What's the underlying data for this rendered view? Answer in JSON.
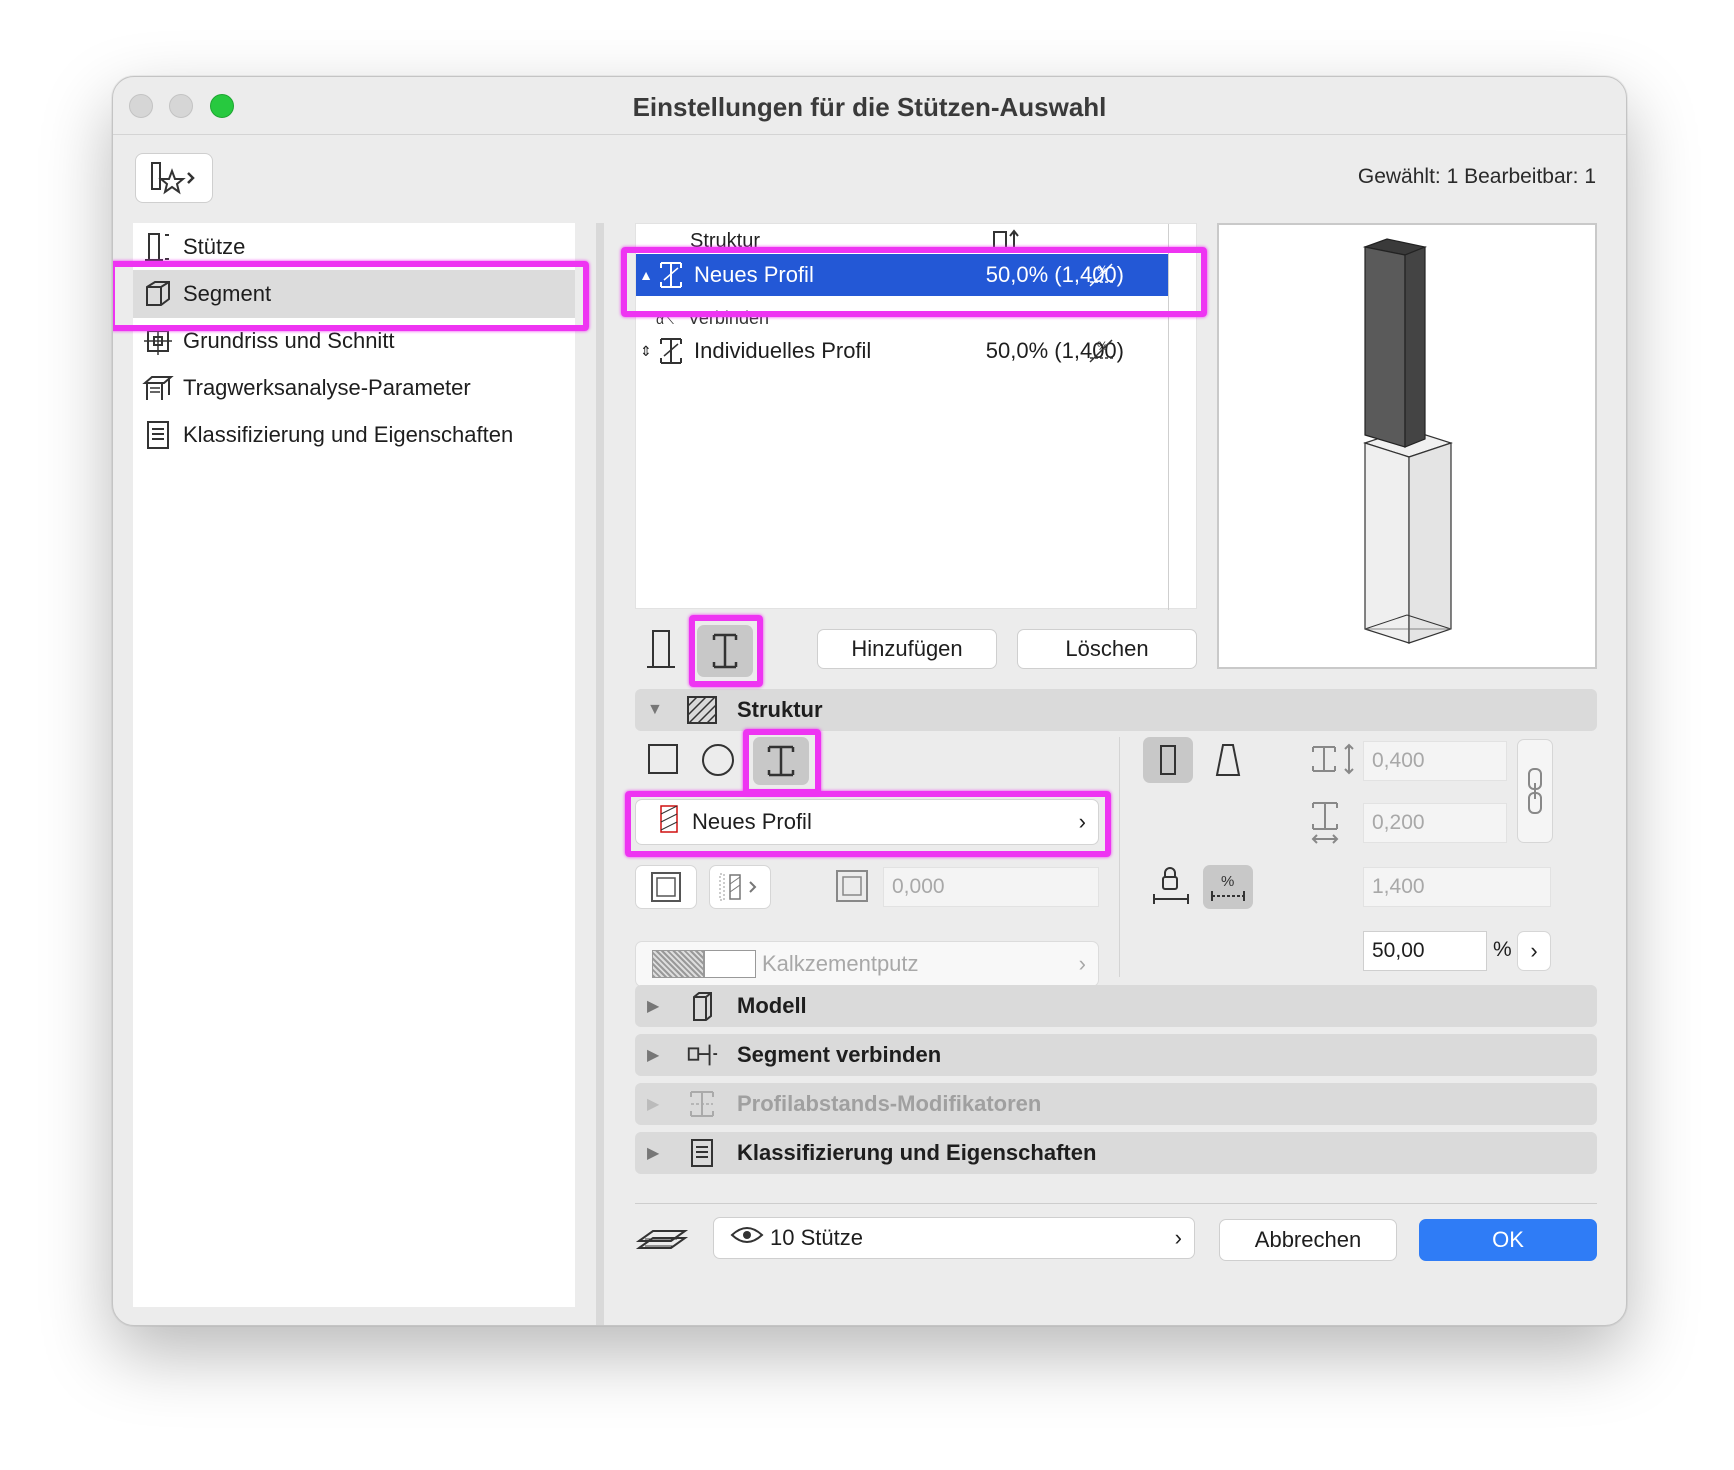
{
  "window": {
    "title": "Einstellungen für die Stützen-Auswahl",
    "selected_info": "Gewählt: 1 Bearbeitbar: 1"
  },
  "sidebar": {
    "items": [
      {
        "label": "Stütze",
        "icon": "column-icon"
      },
      {
        "label": "Segment",
        "icon": "segment-icon",
        "selected": true
      },
      {
        "label": "Grundriss und Schnitt",
        "icon": "floorplan-icon"
      },
      {
        "label": "Tragwerksanalyse-Parameter",
        "icon": "structural-analysis-icon"
      },
      {
        "label": "Klassifizierung und Eigenschaften",
        "icon": "classification-icon"
      }
    ]
  },
  "segments": {
    "header": "Struktur",
    "connect_label": "Verbinden",
    "rows": [
      {
        "name": "Neues Profil",
        "value": "50,0% (1,400)",
        "selected": true
      },
      {
        "name": "Individuelles Profil",
        "value": "50,0% (1,400)",
        "selected": false
      }
    ],
    "add_label": "Hinzufügen",
    "delete_label": "Löschen"
  },
  "struktur": {
    "title": "Struktur",
    "profile_label": "Neues Profil",
    "core_value": "0,000",
    "material": "Kalkzementputz",
    "width_value": "0,400",
    "depth_value": "0,200",
    "length_value": "1,400",
    "percent_value": "50,00",
    "percent_unit": "%"
  },
  "sections": [
    {
      "label": "Modell",
      "disabled": false
    },
    {
      "label": "Segment verbinden",
      "disabled": false
    },
    {
      "label": "Profilabstands-Modifikatoren",
      "disabled": true
    },
    {
      "label": "Klassifizierung und Eigenschaften",
      "disabled": false
    }
  ],
  "footer": {
    "layer": "10 Stütze",
    "cancel_label": "Abbrechen",
    "ok_label": "OK"
  },
  "colors": {
    "selection": "#2358d6",
    "highlight": "#ee34f2",
    "ok_button": "#2f7cf6"
  }
}
